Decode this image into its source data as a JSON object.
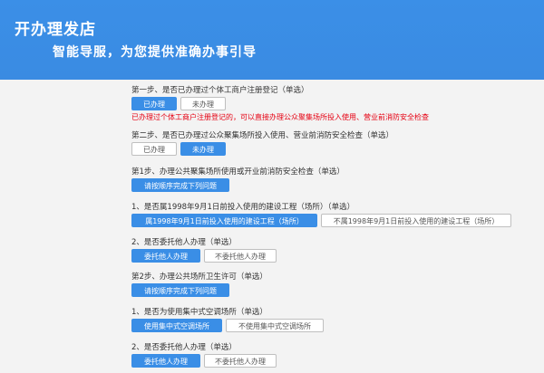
{
  "header": {
    "title": "开办理发店",
    "subtitle": "智能导服，为您提供准确办事引导"
  },
  "step1": {
    "question": "第一步、是否已办理过个体工商户注册登记（单选）",
    "yes": "已办理",
    "no": "未办理",
    "note": "已办理过个体工商户注册登记的，可以直接办理公众聚集场所投入使用、营业前消防安全检查"
  },
  "step2": {
    "question": "第二步、是否已办理过公众聚集场所投入使用、营业前消防安全检查（单选）",
    "yes": "已办理",
    "no": "未办理"
  },
  "section1": {
    "title": "第1步、办理公共聚集场所使用或开业前消防安全检查（单选）",
    "order_button": "请按顺序完成下列问题",
    "q1": {
      "question": "1、是否属1998年9月1日前投入使用的建设工程（场所）（单选）",
      "opt_a": "属1998年9月1日前投入使用的建设工程（场所）",
      "opt_b": "不属1998年9月1日前投入使用的建设工程（场所）"
    },
    "q2": {
      "question": "2、是否委托他人办理（单选）",
      "opt_a": "委托他人办理",
      "opt_b": "不委托他人办理"
    }
  },
  "section2": {
    "title": "第2步、办理公共场所卫生许可（单选）",
    "order_button": "请按顺序完成下列问题",
    "q1": {
      "question": "1、是否为使用集中式空调场所（单选）",
      "opt_a": "使用集中式空调场所",
      "opt_b": "不使用集中式空调场所"
    },
    "q2": {
      "question": "2、是否委托他人办理（单选）",
      "opt_a": "委托他人办理",
      "opt_b": "不委托他人办理"
    }
  }
}
